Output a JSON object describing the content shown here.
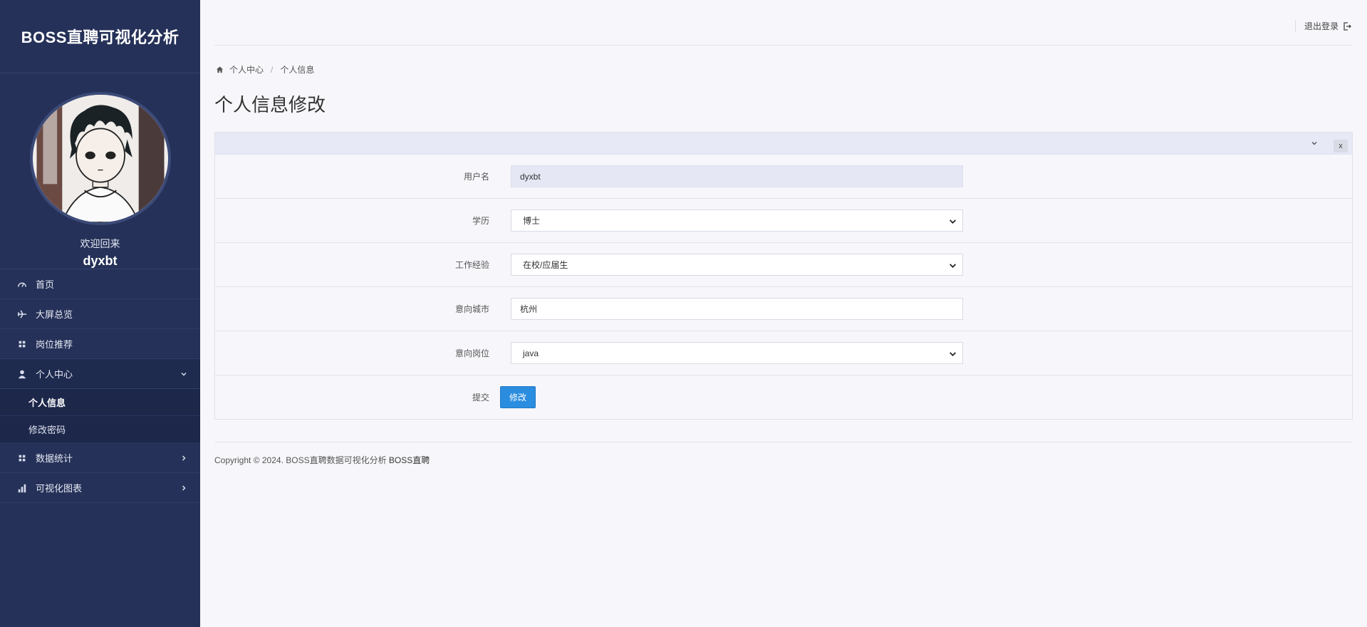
{
  "sidebar": {
    "brand": "BOSS直聘可视化分析",
    "welcome": "欢迎回来",
    "username": "dyxbt",
    "items": [
      {
        "label": "首页",
        "icon": "dashboard-icon"
      },
      {
        "label": "大屏总览",
        "icon": "plane-icon"
      },
      {
        "label": "岗位推荐",
        "icon": "grid-icon"
      },
      {
        "label": "个人中心",
        "icon": "user-icon",
        "expanded": true
      },
      {
        "label": "数据统计",
        "icon": "grid-icon"
      },
      {
        "label": "可视化图表",
        "icon": "bar-chart-icon"
      }
    ],
    "subitems": [
      {
        "label": "个人信息",
        "active": true
      },
      {
        "label": "修改密码",
        "active": false
      }
    ]
  },
  "topbar": {
    "logout": "退出登录"
  },
  "breadcrumb": {
    "root": "个人中心",
    "sep": "/",
    "current": "个人信息"
  },
  "page": {
    "title": "个人信息修改"
  },
  "panel": {
    "close": "x"
  },
  "form": {
    "username": {
      "label": "用户名",
      "value": "dyxbt"
    },
    "education": {
      "label": "学历",
      "value": "博士"
    },
    "experience": {
      "label": "工作经验",
      "value": "在校/应届生"
    },
    "city": {
      "label": "意向城市",
      "value": "杭州"
    },
    "position": {
      "label": "意向岗位",
      "value": "java"
    },
    "submit": {
      "label": "提交",
      "button": "修改"
    }
  },
  "footer": {
    "copyright": "Copyright © 2024. BOSS直聘数据可视化分析 ",
    "brand": "BOSS直聘"
  },
  "colors": {
    "sidebar": "#253158",
    "accent": "#2a8de0",
    "background": "#f7f7fb"
  }
}
